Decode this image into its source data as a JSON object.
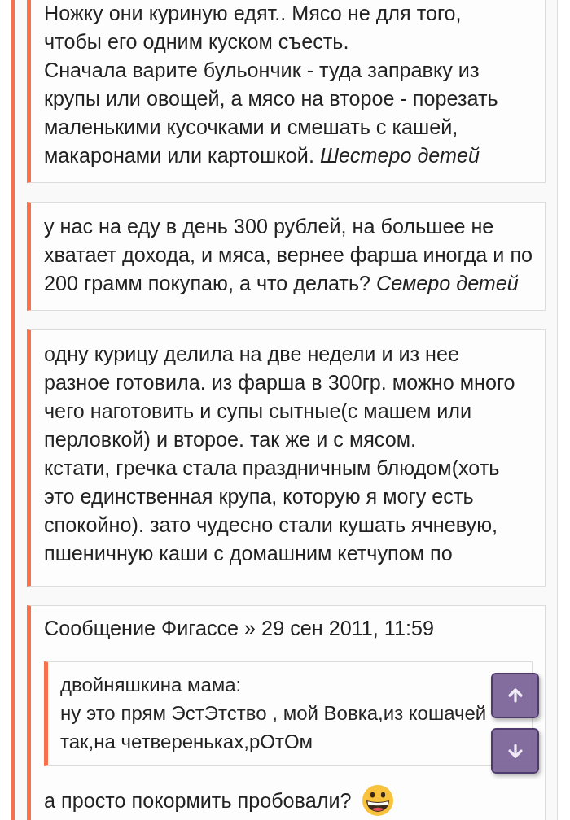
{
  "thread": {
    "blocks": [
      {
        "kind": "quote",
        "lines": [
          "Ножку они куриную едят.. Мясо не для того,",
          "чтобы его одним куском съесть.",
          "Сначала варите бульончик - туда заправку из",
          "крупы или овощей, а мясо на второе - порезать",
          "маленькими кусочками и смешать с кашей,",
          "макаронами или картошкой. *Шестеро детей*"
        ]
      },
      {
        "kind": "quote",
        "lines": [
          "у нас на еду в день 300 рублей, на большее не",
          "хватает дохода, и мяса, вернее фарша иногда и по",
          "200 грамм покупаю, а что делать? *Семеро детей*"
        ]
      },
      {
        "kind": "quote",
        "lines": [
          "одну курицу делила на две недели и из нее",
          "разное готовила. из фарша в 300гр. можно много",
          "чего наготовить и супы сытные(с машем или",
          "перловкой) и второе. так же и с мясом.",
          "кстати, гречка стала праздничным блюдом(хоть",
          "это единственная крупа, которую я могу есть",
          "спокойно). зато чудесно стали кушать ячневую,",
          "пшеничную каши с домашним кетчупом по"
        ]
      },
      {
        "kind": "post",
        "header": "Сообщение Фигассе » 29 сен 2011, 11:59",
        "quote": {
          "lines": [
            "двойняшкина мама:",
            "ну это прям ЭстЭтство , мой Вовка,из кошачей",
            "так,на четвереньках,рОтОм"
          ]
        },
        "reply": "а просто покормить пробовали?"
      }
    ]
  },
  "scroll_buttons": [
    {
      "kind": "up"
    },
    {
      "kind": "down"
    }
  ]
}
